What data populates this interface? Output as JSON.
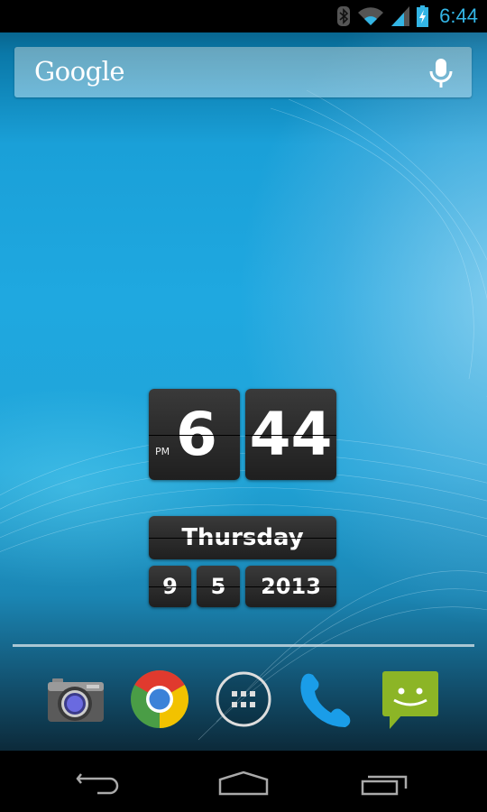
{
  "status_bar": {
    "icons": [
      "bluetooth-icon",
      "wifi-icon",
      "cell-signal-icon",
      "battery-charging-icon"
    ],
    "time": "6:44",
    "accent_color": "#33b5e5"
  },
  "search_bar": {
    "logo_text": "Google",
    "voice_search_icon": "microphone-icon"
  },
  "clock_widget": {
    "hour": "6",
    "minute": "44",
    "ampm": "PM",
    "weekday": "Thursday",
    "month": "9",
    "day": "5",
    "year": "2013"
  },
  "dock": {
    "apps": [
      {
        "name": "Camera",
        "icon": "camera-icon"
      },
      {
        "name": "Chrome",
        "icon": "chrome-icon"
      },
      {
        "name": "All Apps",
        "icon": "app-drawer-icon"
      },
      {
        "name": "Phone",
        "icon": "phone-icon"
      },
      {
        "name": "Messaging",
        "icon": "messaging-icon"
      }
    ]
  },
  "nav_bar": {
    "buttons": [
      {
        "name": "Back",
        "icon": "back-icon"
      },
      {
        "name": "Home",
        "icon": "home-icon"
      },
      {
        "name": "Recent Apps",
        "icon": "recents-icon"
      }
    ]
  }
}
